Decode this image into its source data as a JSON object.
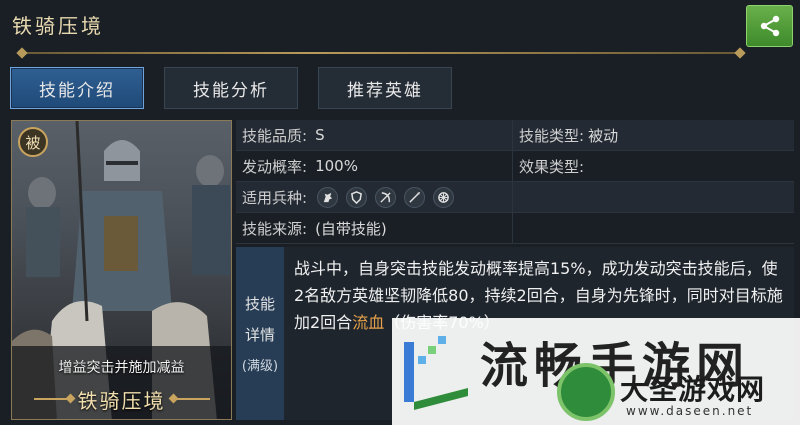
{
  "header": {
    "title": "铁骑压境"
  },
  "tabs": [
    {
      "label": "技能介绍",
      "active": true
    },
    {
      "label": "技能分析",
      "active": false
    },
    {
      "label": "推荐英雄",
      "active": false
    }
  ],
  "card": {
    "badge": "被",
    "subtitle": "增益突击并施加减益",
    "name": "铁骑压境"
  },
  "info": {
    "quality_label": "技能品质:",
    "quality_value": "S",
    "type_label": "技能类型:",
    "type_value": "被动",
    "prob_label": "发动概率:",
    "prob_value": "100%",
    "effect_label": "效果类型:",
    "effect_value": "",
    "troops_label": "适用兵种:",
    "troop_icons": [
      "cavalry-icon",
      "shield-icon",
      "bow-icon",
      "spear-icon",
      "wheel-icon"
    ],
    "source_label": "技能来源:",
    "source_value": "(自带技能)"
  },
  "detail": {
    "label_line1": "技能",
    "label_line2": "详情",
    "label_line3": "(满级)",
    "text_part1": "战斗中，自身突击技能发动概率提高15%，成功发动突击技能后，使2名敌方英雄坚韧降低80，持续2回合，自身为先锋时，同时对目标施加2回合",
    "text_highlight": "流血",
    "text_part2": "（伤害率70%）"
  },
  "watermark": {
    "brand_big": "流畅手游网",
    "brand_name": "大圣游戏网",
    "url": "www.daseen.net"
  },
  "colors": {
    "accent_blue": "#2f5f93",
    "share_green": "#4e9c37",
    "gold": "#c9a45f",
    "highlight": "#e6a14a"
  }
}
